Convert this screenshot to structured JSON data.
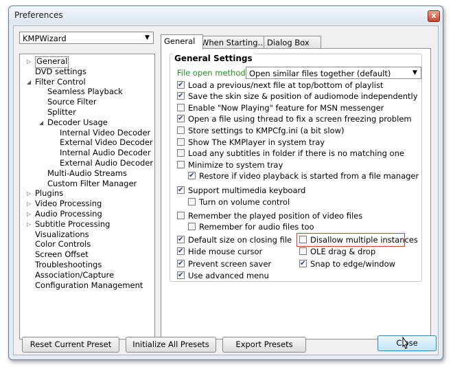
{
  "window": {
    "title": "Preferences",
    "close_glyph": "x"
  },
  "preset": {
    "selected": "KMPWizard"
  },
  "tree": [
    {
      "label": "General",
      "expander": "closed",
      "level": 0,
      "selected": true
    },
    {
      "label": "DVD settings",
      "expander": "none",
      "level": 0
    },
    {
      "label": "Filter Control",
      "expander": "open",
      "level": 0
    },
    {
      "label": "Seamless Playback",
      "expander": "none",
      "level": 1
    },
    {
      "label": "Source Filter",
      "expander": "none",
      "level": 1
    },
    {
      "label": "Splitter",
      "expander": "none",
      "level": 1
    },
    {
      "label": "Decoder Usage",
      "expander": "open",
      "level": 1
    },
    {
      "label": "Internal Video Decoder",
      "expander": "none",
      "level": 2
    },
    {
      "label": "External Video Decoder",
      "expander": "none",
      "level": 2
    },
    {
      "label": "Internal Audio Decoder",
      "expander": "none",
      "level": 2
    },
    {
      "label": "External Audio Decoder",
      "expander": "none",
      "level": 2
    },
    {
      "label": "Multi-Audio Streams",
      "expander": "none",
      "level": 1
    },
    {
      "label": "Custom Filter Manager",
      "expander": "none",
      "level": 1
    },
    {
      "label": "Plugins",
      "expander": "closed",
      "level": 0
    },
    {
      "label": "Video Processing",
      "expander": "closed",
      "level": 0
    },
    {
      "label": "Audio Processing",
      "expander": "closed",
      "level": 0
    },
    {
      "label": "Subtitle Processing",
      "expander": "closed",
      "level": 0
    },
    {
      "label": "Visualizations",
      "expander": "none",
      "level": 0
    },
    {
      "label": "Color Controls",
      "expander": "none",
      "level": 0
    },
    {
      "label": "Screen Offset",
      "expander": "none",
      "level": 0
    },
    {
      "label": "Troubleshootings",
      "expander": "none",
      "level": 0
    },
    {
      "label": "Association/Capture",
      "expander": "none",
      "level": 0
    },
    {
      "label": "Configuration Management",
      "expander": "none",
      "level": 0
    }
  ],
  "tabs": [
    {
      "label": "General",
      "active": true
    },
    {
      "label": "When Starting...",
      "active": false
    },
    {
      "label": "Dialog Box",
      "active": false
    }
  ],
  "general": {
    "group_label": "General Settings",
    "file_open_label": "File open method:",
    "file_open_value": "Open similar files together (default)",
    "label_color": "#2a8a2a",
    "options": [
      {
        "label": "Load a previous/next file at top/bottom of playlist",
        "checked": true
      },
      {
        "label": "Save the skin size & position of audiomode independently",
        "checked": true
      },
      {
        "label": "Enable \"Now Playing\" feature for MSN messenger",
        "checked": false
      },
      {
        "label": "Open a file using thread to fix a screen freezing problem",
        "checked": true
      },
      {
        "label": "Store settings to KMPCfg.ini (a bit slow)",
        "checked": false
      },
      {
        "label": "Show The KMPlayer in system tray",
        "checked": false
      },
      {
        "label": "Load any subtitles in folder if there is no matching one",
        "checked": false
      },
      {
        "label": "Minimize to system tray",
        "checked": false
      },
      {
        "label": "Restore if video playback is started from a file manager",
        "checked": true
      },
      {
        "label": "Support multimedia keyboard",
        "checked": true
      },
      {
        "label": "Turn on volume control",
        "checked": false
      },
      {
        "label": "Remember the played position of video files",
        "checked": false
      },
      {
        "label": "Remember for audio files too",
        "checked": false
      },
      {
        "label": "Default size on closing file",
        "checked": true
      },
      {
        "label": "Disallow multiple instances",
        "checked": false,
        "highlight": true
      },
      {
        "label": "Hide mouse cursor",
        "checked": true
      },
      {
        "label": "OLE drag & drop",
        "checked": false
      },
      {
        "label": "Prevent screen saver",
        "checked": true
      },
      {
        "label": "Snap to edge/window",
        "checked": true
      },
      {
        "label": "Use advanced menu",
        "checked": true
      }
    ]
  },
  "buttons": {
    "reset": "Reset Current Preset",
    "init": "Initialize All Presets",
    "export": "Export Presets",
    "close": "Close"
  }
}
